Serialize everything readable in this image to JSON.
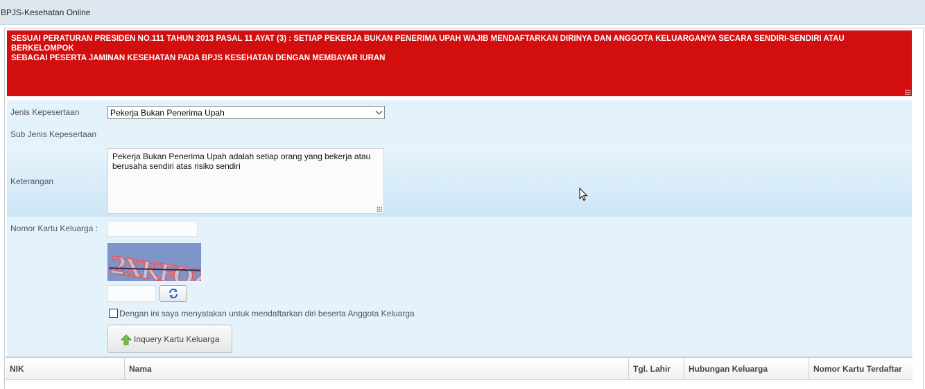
{
  "window": {
    "title": "BPJS-Kesehatan Online"
  },
  "notice": {
    "text_line1": "SESUAI PERATURAN PRESIDEN NO.111 TAHUN 2013 PASAL 11 AYAT (3) : SETIAP PEKERJA BUKAN PENERIMA UPAH WAJIB MENDAFTARKAN DIRINYA DAN ANGGOTA KELUARGANYA SECARA SENDIRI-SENDIRI ATAU BERKELOMPOK",
    "text_line2": "SEBAGAI PESERTA JAMINAN KESEHATAN PADA BPJS KESEHATAN DENGAN MEMBAYAR IURAN",
    "color": "#d20e0e"
  },
  "form": {
    "jenis_label": "Jenis Kepesertaan",
    "jenis_value": "Pekerja Bukan Penerima Upah",
    "sub_jenis_label": "Sub Jenis Kepesertaan",
    "keterangan_label": "Keterangan",
    "keterangan_text": "Pekerja Bukan Penerima Upah adalah setiap orang yang bekerja atau berusaha sendiri atas risiko sendiri",
    "nomor_kk_label": "Nomor Kartu Keluarga :",
    "nomor_kk_value": "",
    "captcha_text": "2XKFQZ",
    "captcha_input_value": "",
    "consent_label": "Dengan ini saya menyatakan untuk mendaftarkan diri beserta Anggota Keluarga",
    "consent_checked": false,
    "inquery_button": "Inquery Kartu Keluarga",
    "icons": {
      "refresh": "refresh-icon",
      "inquery": "arrow-up-icon",
      "select": "chevron-down-icon"
    }
  },
  "table": {
    "columns": [
      "NIK",
      "Nama",
      "Tgl. Lahir",
      "Hubungan Keluarga",
      "Nomor Kartu Terdaftar"
    ]
  }
}
